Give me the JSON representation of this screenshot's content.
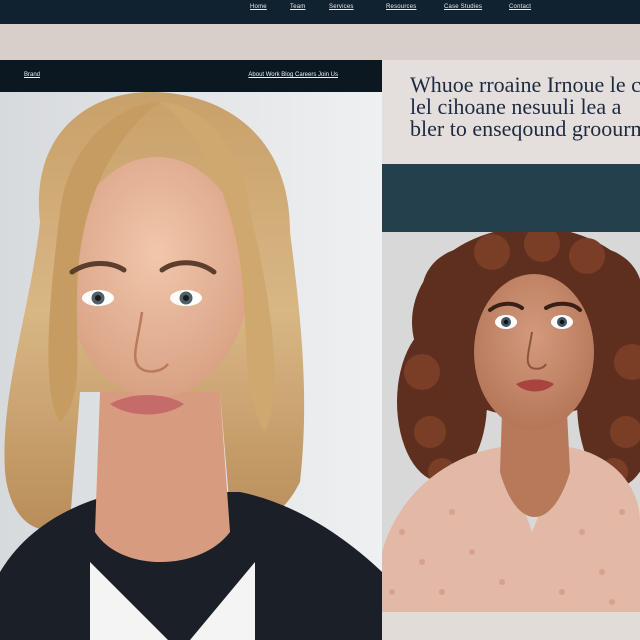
{
  "top_nav": {
    "items": [
      "Home",
      "Team",
      "Services",
      "Resources",
      "Case Studies",
      "Contact"
    ]
  },
  "left_card": {
    "brand": "Brand",
    "nav_links": "About  Work  Blog  Careers  Join  Us"
  },
  "right_column": {
    "headline_lines": [
      "Whuoe rroaine Irnoue le c",
      "lel cihoane nesuuli lea a",
      "bler to enseqound groourm"
    ]
  },
  "photos": {
    "left": "portrait-blonde-woman",
    "right": "portrait-curly-haired-woman"
  },
  "colors": {
    "nav_bg": "#10222f",
    "card_bar_bg": "#0b1721",
    "teal_band": "#24404d",
    "headline": "#1d2a41",
    "page_bg": "#d8d0cb"
  }
}
